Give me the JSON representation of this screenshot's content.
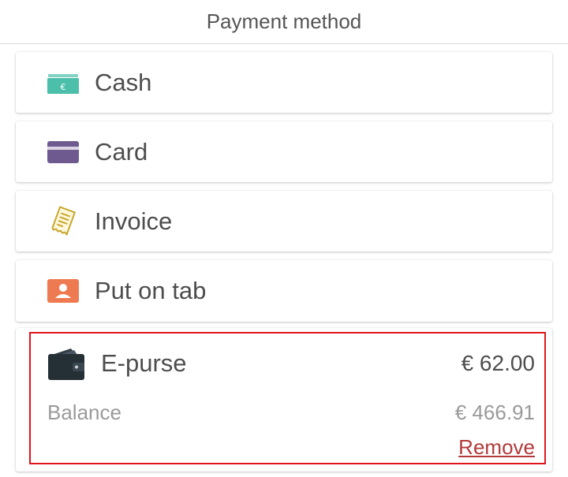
{
  "header": {
    "title": "Payment method"
  },
  "methods": [
    {
      "label": "Cash",
      "icon": "cash-icon",
      "color": "#4bbfa9"
    },
    {
      "label": "Card",
      "icon": "card-icon",
      "color": "#6f5a8f"
    },
    {
      "label": "Invoice",
      "icon": "invoice-icon",
      "color": "#c8a62e"
    },
    {
      "label": "Put on tab",
      "icon": "person-card-icon",
      "color": "#ee7a51"
    }
  ],
  "epurse": {
    "label": "E-purse",
    "icon": "wallet-icon",
    "amount": "€  62.00",
    "balance_label": "Balance",
    "balance_value": "€  466.91",
    "remove_label": "Remove",
    "highlight_color": "#e0151b"
  }
}
